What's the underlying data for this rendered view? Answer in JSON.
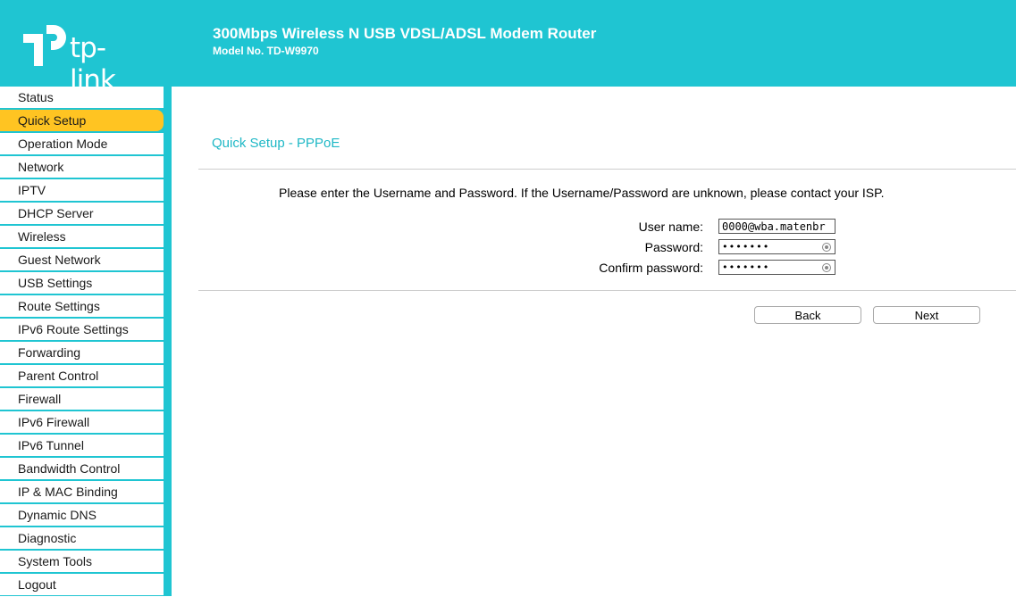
{
  "header": {
    "brand": "tp-link",
    "product_name": "300Mbps Wireless N USB VDSL/ADSL Modem Router",
    "model": "Model No. TD-W9970",
    "bg_color": "#1fc5d2"
  },
  "sidebar": {
    "active_color": "#ffc422",
    "items": [
      {
        "label": "Status"
      },
      {
        "label": "Quick Setup",
        "active": true
      },
      {
        "label": "Operation Mode"
      },
      {
        "label": "Network"
      },
      {
        "label": "IPTV"
      },
      {
        "label": "DHCP Server"
      },
      {
        "label": "Wireless"
      },
      {
        "label": "Guest Network"
      },
      {
        "label": "USB Settings"
      },
      {
        "label": "Route Settings"
      },
      {
        "label": "IPv6 Route Settings"
      },
      {
        "label": "Forwarding"
      },
      {
        "label": "Parent Control"
      },
      {
        "label": "Firewall"
      },
      {
        "label": "IPv6 Firewall"
      },
      {
        "label": "IPv6 Tunnel"
      },
      {
        "label": "Bandwidth Control"
      },
      {
        "label": "IP & MAC Binding"
      },
      {
        "label": "Dynamic DNS"
      },
      {
        "label": "Diagnostic"
      },
      {
        "label": "System Tools"
      },
      {
        "label": "Logout"
      }
    ]
  },
  "main": {
    "title": "Quick Setup - PPPoE",
    "instruction": "Please enter the Username and Password. If the Username/Password are unknown, please contact your ISP.",
    "form": {
      "username_label": "User name:",
      "username_value": "0000@wba.matenbr",
      "password_label": "Password:",
      "password_value": "•••••••",
      "confirm_label": "Confirm password:",
      "confirm_value": "•••••••"
    },
    "buttons": {
      "back": "Back",
      "next": "Next"
    }
  }
}
